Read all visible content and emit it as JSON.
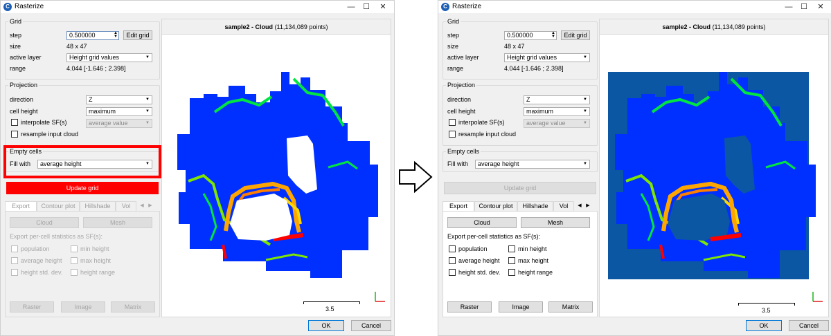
{
  "window_title": "Rasterize",
  "titlebar_buttons": {
    "minimize": "—",
    "maximize": "☐",
    "close": "✕"
  },
  "grid": {
    "title": "Grid",
    "step_label": "step",
    "step_value": "0.500000",
    "edit_grid": "Edit grid",
    "size_label": "size",
    "size_value": "48 x 47",
    "active_layer_label": "active layer",
    "active_layer_value": "Height grid values",
    "range_label": "range",
    "range_value": "4.044 [-1.646 ; 2.398]"
  },
  "projection": {
    "title": "Projection",
    "direction_label": "direction",
    "direction_value": "Z",
    "cell_height_label": "cell height",
    "cell_height_value": "maximum",
    "interpolate_label": "interpolate SF(s)",
    "interpolate_value": "average value",
    "resample_label": "resample input cloud"
  },
  "empty_cells": {
    "title": "Empty cells",
    "fill_label": "Fill with",
    "fill_value": "average height"
  },
  "update_grid": "Update grid",
  "tabs": [
    "Export",
    "Contour plot",
    "Hillshade",
    "Vol"
  ],
  "export": {
    "cloud": "Cloud",
    "mesh": "Mesh",
    "stats_label": "Export per-cell statistics as SF(s):",
    "population": "population",
    "min_height": "min height",
    "average_height": "average height",
    "max_height": "max height",
    "height_std": "height std. dev.",
    "height_range": "height range",
    "raster": "Raster",
    "image": "Image",
    "matrix": "Matrix"
  },
  "viewport": {
    "cloud_name": "sample2 - Cloud",
    "points": "(11,134,089 points)",
    "scale": "3.5"
  },
  "footer": {
    "ok": "OK",
    "cancel": "Cancel"
  },
  "arrow_icon": "right-arrow-icon",
  "colors": {
    "highlight": "#ff0000",
    "empty_fill": "#0b57a4",
    "low": "#0030ff",
    "high": "#ff0000"
  }
}
